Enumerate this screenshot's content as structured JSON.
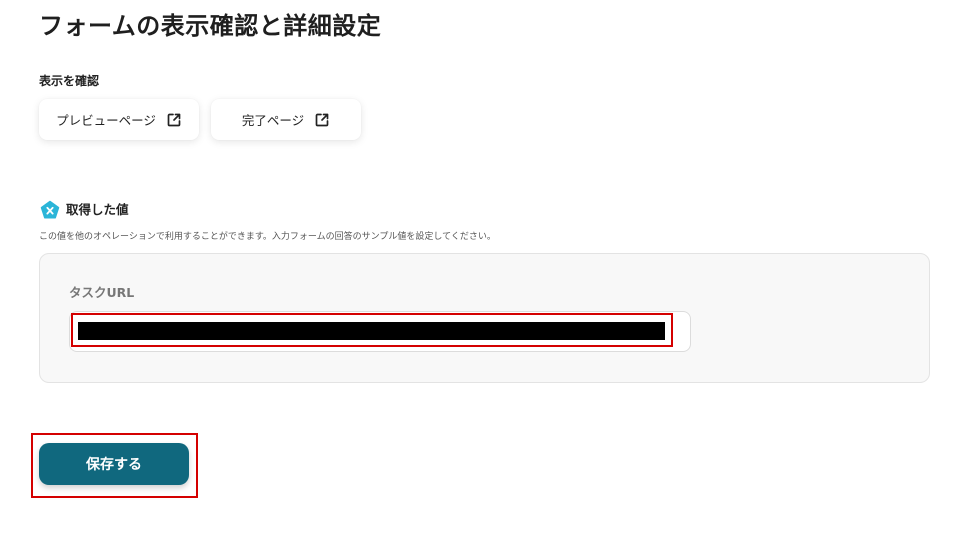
{
  "page": {
    "title": "フォームの表示確認と詳細設定"
  },
  "display_check": {
    "label": "表示を確認",
    "preview_button": {
      "label": "プレビューページ",
      "icon": "external-link-icon"
    },
    "complete_button": {
      "label": "完了ページ",
      "icon": "external-link-icon"
    }
  },
  "acquired_values": {
    "icon": "pentagon-x-icon",
    "title": "取得した値",
    "description": "この値を他のオペレーションで利用することができます。入力フォームの回答のサンプル値を設定してください。",
    "fields": [
      {
        "label": "タスクURL",
        "value": ""
      }
    ]
  },
  "actions": {
    "save_label": "保存する"
  },
  "colors": {
    "primary": "#10687e",
    "highlight": "#d40000",
    "icon_accent": "#2bb5d8"
  }
}
